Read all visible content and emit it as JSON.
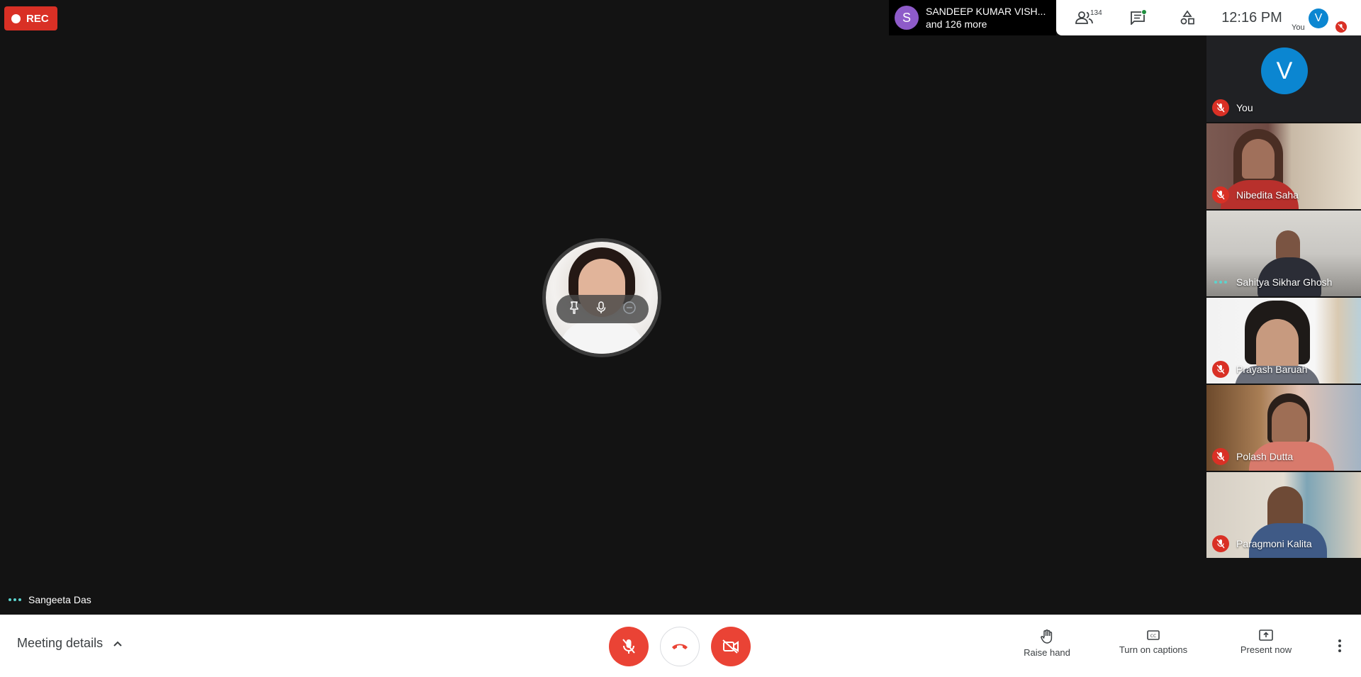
{
  "recording": {
    "label": "REC"
  },
  "presenter_banner": {
    "avatar_letter": "S",
    "name": "SANDEEP KUMAR VISH...",
    "more": "and 126 more"
  },
  "top_bar": {
    "people_count": "134",
    "time": "12:16 PM",
    "self_avatar_letter": "V",
    "self_label": "You"
  },
  "main_stage": {
    "speaker_name": "Sangeeta Das"
  },
  "participants": [
    {
      "name": "You",
      "avatar_letter": "V",
      "status": "muted"
    },
    {
      "name": "Nibedita Saha",
      "status": "muted"
    },
    {
      "name": "Sahitya Sikhar Ghosh",
      "status": "speaking"
    },
    {
      "name": "Prayash Baruah",
      "status": "muted"
    },
    {
      "name": "Polash Dutta",
      "status": "muted"
    },
    {
      "name": "Paragmoni Kalita",
      "status": "muted"
    }
  ],
  "bottom_bar": {
    "meeting_details": "Meeting details",
    "raise_hand": "Raise hand",
    "captions": "Turn on captions",
    "present": "Present now"
  },
  "colors": {
    "accent_red": "#ea4335",
    "avatar_blue": "#0b86d1",
    "avatar_purple": "#8e5bc9",
    "speaking": "#5bd4ce"
  },
  "icons": [
    "rec-dot-icon",
    "people-icon",
    "chat-icon",
    "activities-icon",
    "mic-off-icon",
    "pin-icon",
    "mic-icon",
    "remove-icon",
    "chevron-up-icon",
    "hangup-icon",
    "camera-off-icon",
    "raise-hand-icon",
    "captions-icon",
    "present-icon",
    "more-vert-icon"
  ]
}
